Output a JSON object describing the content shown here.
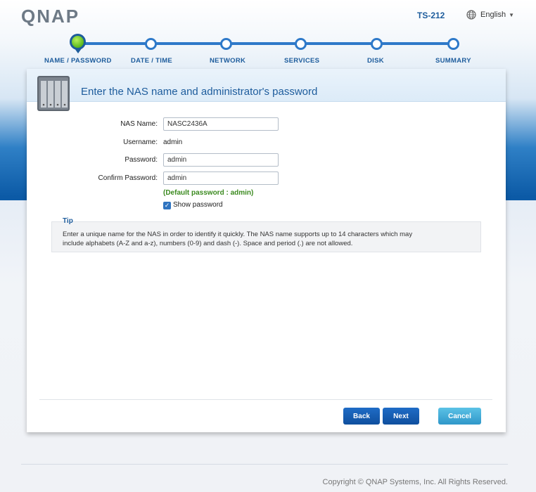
{
  "header": {
    "logo_text": "QNAP",
    "model": "TS-212",
    "language": "English",
    "language_icon": "globe-icon"
  },
  "steps": [
    {
      "label": "NAME / PASSWORD",
      "active": true
    },
    {
      "label": "DATE / TIME",
      "active": false
    },
    {
      "label": "NETWORK",
      "active": false
    },
    {
      "label": "SERVICES",
      "active": false
    },
    {
      "label": "DISK",
      "active": false
    },
    {
      "label": "SUMMARY",
      "active": false
    }
  ],
  "panel": {
    "title": "Enter the NAS name and administrator's password",
    "icon": "nas-device-icon"
  },
  "form": {
    "nas_name_label": "NAS Name:",
    "nas_name_value": "NASC2436A",
    "username_label": "Username:",
    "username_value": "admin",
    "password_label": "Password:",
    "password_value": "admin",
    "confirm_label": "Confirm Password:",
    "confirm_value": "admin",
    "default_hint": "(Default password : admin)",
    "show_password_label": "Show password",
    "show_password_checked": true
  },
  "tip": {
    "label": "Tip",
    "line1": "Enter a unique name for the NAS in order to identify it quickly. The NAS name supports up to 14 characters which may",
    "line2": "include alphabets (A-Z and a-z), numbers (0-9) and dash (-). Space and period (.) are not allowed."
  },
  "buttons": {
    "back": "Back",
    "next": "Next",
    "cancel": "Cancel"
  },
  "footer": {
    "copyright": "Copyright © QNAP Systems, Inc. All Rights Reserved."
  },
  "colors": {
    "accent": "#1d5c9c",
    "step_track": "#2e79c9",
    "hint_green": "#3b8a1f",
    "button_blue": "#0f4f9e",
    "button_cyan": "#2f97c9"
  }
}
